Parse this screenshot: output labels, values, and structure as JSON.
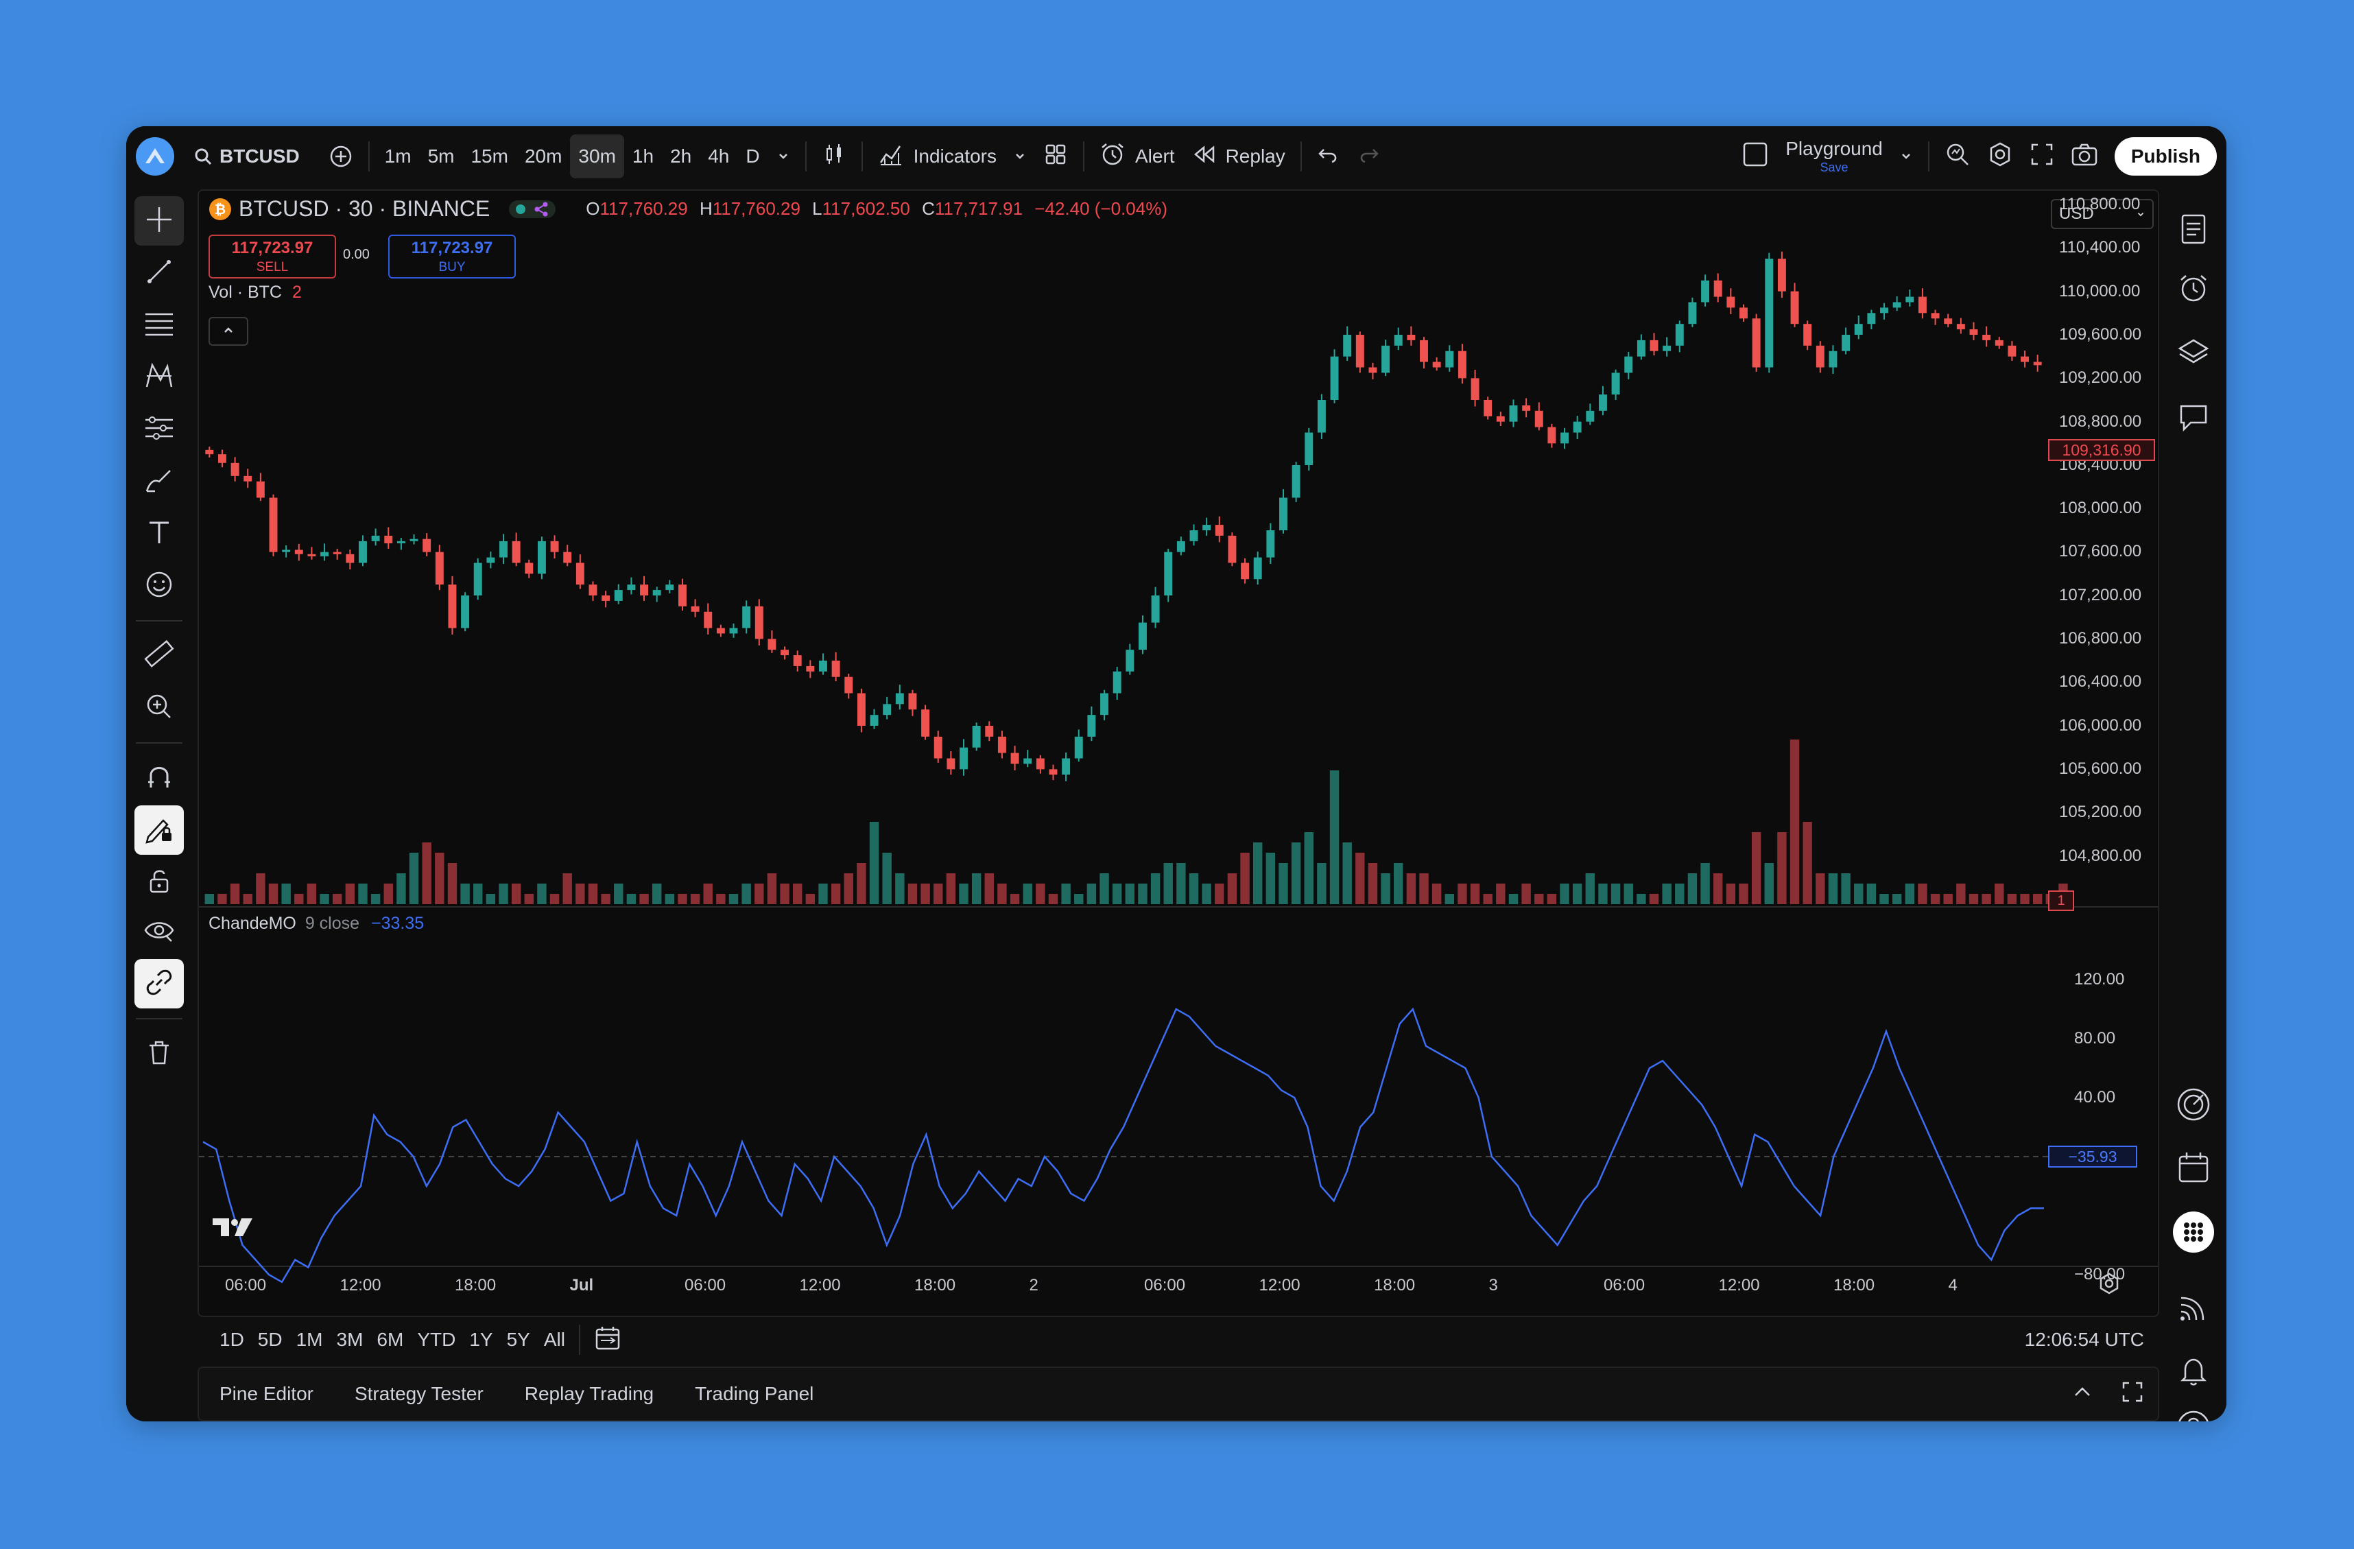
{
  "toolbar": {
    "symbol": "BTCUSD",
    "intervals": [
      "1m",
      "5m",
      "15m",
      "20m",
      "30m",
      "1h",
      "2h",
      "4h",
      "D"
    ],
    "active_interval": "30m",
    "indicators_label": "Indicators",
    "alert_label": "Alert",
    "replay_label": "Replay",
    "layout_name": "Playground",
    "layout_sub": "Save",
    "publish_label": "Publish"
  },
  "legend": {
    "title": "BTCUSD · 30 · BINANCE",
    "o_label": "O",
    "o_value": "117,760.29",
    "h_label": "H",
    "h_value": "117,760.29",
    "l_label": "L",
    "l_value": "117,602.50",
    "c_label": "C",
    "c_value": "117,717.91",
    "change": "−42.40 (−0.04%)",
    "sell_price": "117,723.97",
    "sell_label": "SELL",
    "spread": "0.00",
    "buy_price": "117,723.97",
    "buy_label": "BUY",
    "vol_label": "Vol · BTC",
    "vol_value": "2",
    "currency": "USD",
    "last_price": "109,316.90",
    "vol_tag": "1"
  },
  "oscillator": {
    "name": "ChandeMO",
    "params": "9 close",
    "value": "−33.35",
    "last_tag": "−35.93"
  },
  "price_axis": [
    "110,800.00",
    "110,400.00",
    "110,000.00",
    "109,600.00",
    "109,200.00",
    "108,800.00",
    "108,400.00",
    "108,000.00",
    "107,600.00",
    "107,200.00",
    "106,800.00",
    "106,400.00",
    "106,000.00",
    "105,600.00",
    "105,200.00",
    "104,800.00"
  ],
  "osc_axis": [
    "120.00",
    "80.00",
    "40.00",
    "0.00",
    "−80.00"
  ],
  "time_axis": [
    "06:00",
    "12:00",
    "18:00",
    "Jul",
    "06:00",
    "12:00",
    "18:00",
    "2",
    "06:00",
    "12:00",
    "18:00",
    "3",
    "06:00",
    "12:00",
    "18:00",
    "4"
  ],
  "ranges": [
    "1D",
    "5D",
    "1M",
    "3M",
    "6M",
    "YTD",
    "1Y",
    "5Y",
    "All"
  ],
  "clock": "12:06:54 UTC",
  "panels": [
    "Pine Editor",
    "Strategy Tester",
    "Replay Trading",
    "Trading Panel"
  ],
  "colors": {
    "bull": "#26a69a",
    "bear": "#ef5350",
    "osc_line": "#3d6ef5",
    "background": "#0c0c0c",
    "page": "#3f8ae0"
  },
  "chart_data": {
    "type": "candlestick",
    "price_series_close": [
      108500,
      108420,
      108300,
      108250,
      108100,
      107600,
      107620,
      107580,
      107560,
      107600,
      107580,
      107500,
      107700,
      107750,
      107680,
      107700,
      107720,
      107600,
      107300,
      106900,
      107200,
      107500,
      107550,
      107700,
      107500,
      107400,
      107700,
      107600,
      107500,
      107300,
      107200,
      107150,
      107250,
      107300,
      107200,
      107250,
      107300,
      107100,
      107050,
      106900,
      106850,
      106900,
      107100,
      106800,
      106700,
      106650,
      106550,
      106500,
      106600,
      106450,
      106300,
      106000,
      106100,
      106200,
      106300,
      106150,
      105900,
      105700,
      105600,
      105800,
      106000,
      105900,
      105750,
      105650,
      105700,
      105600,
      105550,
      105700,
      105900,
      106100,
      106300,
      106500,
      106700,
      106950,
      107200,
      107600,
      107700,
      107800,
      107850,
      107750,
      107500,
      107350,
      107550,
      107800,
      108100,
      108400,
      108700,
      109000,
      109400,
      109600,
      109300,
      109250,
      109500,
      109600,
      109550,
      109350,
      109300,
      109450,
      109200,
      109000,
      108850,
      108800,
      108950,
      108900,
      108750,
      108600,
      108700,
      108800,
      108900,
      109050,
      109250,
      109400,
      109550,
      109450,
      109500,
      109700,
      109900,
      110100,
      109950,
      109850,
      109750,
      109300,
      110300,
      110000,
      109700,
      109500,
      109300,
      109450,
      109600,
      109700,
      109800,
      109850,
      109900,
      109950,
      109800,
      109750,
      109700,
      109650,
      109600,
      109550,
      109500,
      109400,
      109350,
      109320
    ],
    "volume": [
      1,
      1,
      2,
      1,
      3,
      2,
      2,
      1,
      2,
      1,
      1,
      2,
      2,
      1,
      2,
      3,
      5,
      6,
      5,
      4,
      2,
      2,
      1,
      2,
      2,
      1,
      2,
      1,
      3,
      2,
      2,
      1,
      2,
      1,
      1,
      2,
      1,
      1,
      1,
      2,
      1,
      1,
      2,
      2,
      3,
      2,
      2,
      1,
      2,
      2,
      3,
      4,
      8,
      5,
      3,
      2,
      2,
      2,
      3,
      2,
      3,
      3,
      2,
      1,
      2,
      2,
      1,
      2,
      1,
      2,
      3,
      2,
      2,
      2,
      3,
      4,
      4,
      3,
      2,
      2,
      3,
      5,
      6,
      5,
      4,
      6,
      7,
      4,
      13,
      6,
      5,
      4,
      3,
      4,
      3,
      3,
      2,
      1,
      2,
      2,
      1,
      2,
      1,
      2,
      1,
      1,
      2,
      2,
      3,
      2,
      2,
      2,
      1,
      1,
      2,
      2,
      3,
      4,
      3,
      2,
      2,
      7,
      4,
      7,
      16,
      8,
      3,
      3,
      3,
      2,
      2,
      1,
      1,
      2,
      2,
      1,
      1,
      2,
      1,
      1,
      2,
      1,
      1,
      1,
      1,
      2
    ],
    "oscillator": [
      10,
      5,
      -30,
      -60,
      -70,
      -80,
      -85,
      -70,
      -75,
      -55,
      -40,
      -30,
      -20,
      28,
      15,
      10,
      0,
      -20,
      -5,
      20,
      25,
      10,
      -5,
      -15,
      -20,
      -10,
      5,
      30,
      20,
      10,
      -10,
      -30,
      -25,
      10,
      -20,
      -35,
      -40,
      -5,
      -20,
      -40,
      -20,
      10,
      -10,
      -30,
      -40,
      -5,
      -15,
      -30,
      0,
      -10,
      -20,
      -35,
      -60,
      -40,
      -5,
      15,
      -20,
      -35,
      -25,
      -10,
      -20,
      -30,
      -15,
      -20,
      0,
      -10,
      -25,
      -30,
      -15,
      5,
      20,
      40,
      60,
      80,
      100,
      95,
      85,
      75,
      70,
      65,
      60,
      55,
      45,
      40,
      20,
      -20,
      -30,
      -10,
      20,
      30,
      60,
      90,
      100,
      75,
      70,
      65,
      60,
      40,
      0,
      -10,
      -20,
      -40,
      -50,
      -60,
      -45,
      -30,
      -20,
      0,
      20,
      40,
      60,
      65,
      55,
      45,
      35,
      20,
      0,
      -20,
      15,
      10,
      -5,
      -20,
      -30,
      -40,
      0,
      20,
      40,
      60,
      85,
      60,
      40,
      20,
      0,
      -20,
      -40,
      -60,
      -70,
      -50,
      -40,
      -35,
      -35
    ]
  }
}
